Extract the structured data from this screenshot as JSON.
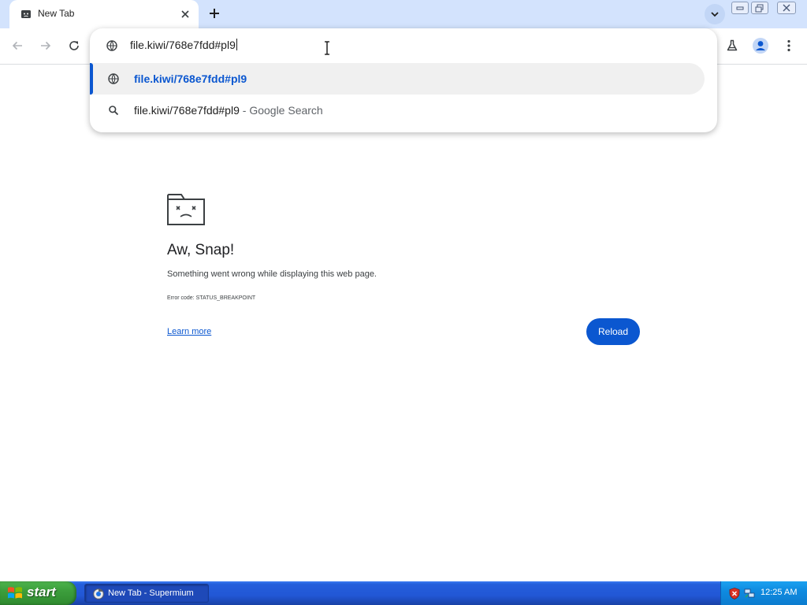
{
  "browser": {
    "tab": {
      "title": "New Tab",
      "close_icon": "close-icon",
      "favicon": "sad-tab-icon"
    },
    "new_tab_icon": "plus-icon",
    "tab_search_icon": "chevron-down-icon"
  },
  "window_controls": {
    "minimize_icon": "minimize-icon",
    "maximize_icon": "restore-icon",
    "close_icon": "close-icon"
  },
  "toolbar": {
    "back_icon": "arrow-left-icon",
    "forward_icon": "arrow-right-icon",
    "reload_icon": "reload-icon",
    "labs_icon": "flask-icon",
    "profile_icon": "person-icon",
    "menu_icon": "kebab-menu-icon"
  },
  "omnibox": {
    "input_value": "file.kiwi/768e7fdd#pl9",
    "suggestions": [
      {
        "icon": "globe-icon",
        "text": "file.kiwi/768e7fdd#pl9",
        "suffix": ""
      },
      {
        "icon": "search-icon",
        "text": "file.kiwi/768e7fdd#pl9",
        "suffix": " - Google Search"
      }
    ]
  },
  "error_page": {
    "icon": "sad-folder-icon",
    "title": "Aw, Snap!",
    "message": "Something went wrong while displaying this web page.",
    "error_code": "Error code: STATUS_BREAKPOINT",
    "learn_more": "Learn more",
    "reload_label": "Reload"
  },
  "taskbar": {
    "start_label": "start",
    "task_label": "New Tab - Supermium",
    "clock": "12:25 AM"
  },
  "colors": {
    "accent": "#0b57d0",
    "tabstrip": "#d3e3fd",
    "taskbar": "#245edb",
    "start_green": "#3c9e3c"
  }
}
